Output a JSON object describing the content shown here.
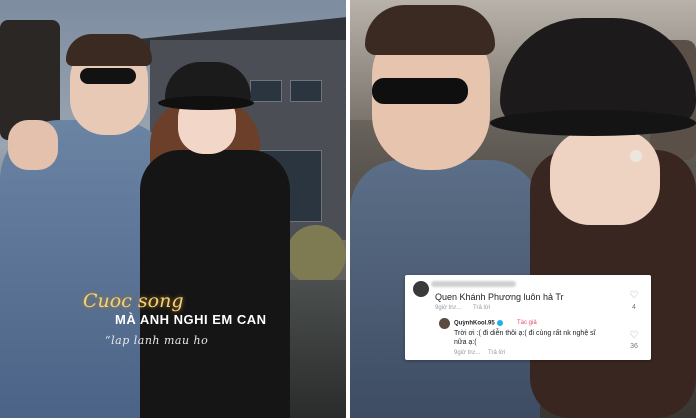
{
  "left_panel": {
    "caption_line1": "Cuoc song",
    "caption_line2": "MÀ ANH NGHI EM CAN",
    "caption_line3": "“lap lanh mau ho"
  },
  "comment_card": {
    "first_comment": {
      "text": "Quen Khánh Phương luôn hả Tr",
      "meta_time": "9giờ trư...",
      "meta_reply": "Trả lời",
      "like_count": "4"
    },
    "reply_comment": {
      "author": "QuỳnhKool.95",
      "author_badge": "Tác giả",
      "text_line1": "Trời ơi :( đi diễn thôi ạ:( đi cùng rất nk nghệ sĩ",
      "text_line2": "nữa ạ:(",
      "meta_time": "9giờ trư...",
      "meta_reply": "Trả lời",
      "like_count": "36"
    },
    "icons": {
      "like": "heart-icon",
      "verified": "verified-icon"
    }
  },
  "colors": {
    "caption_gold": "#f3d37a",
    "author_badge": "#e84a6a"
  }
}
